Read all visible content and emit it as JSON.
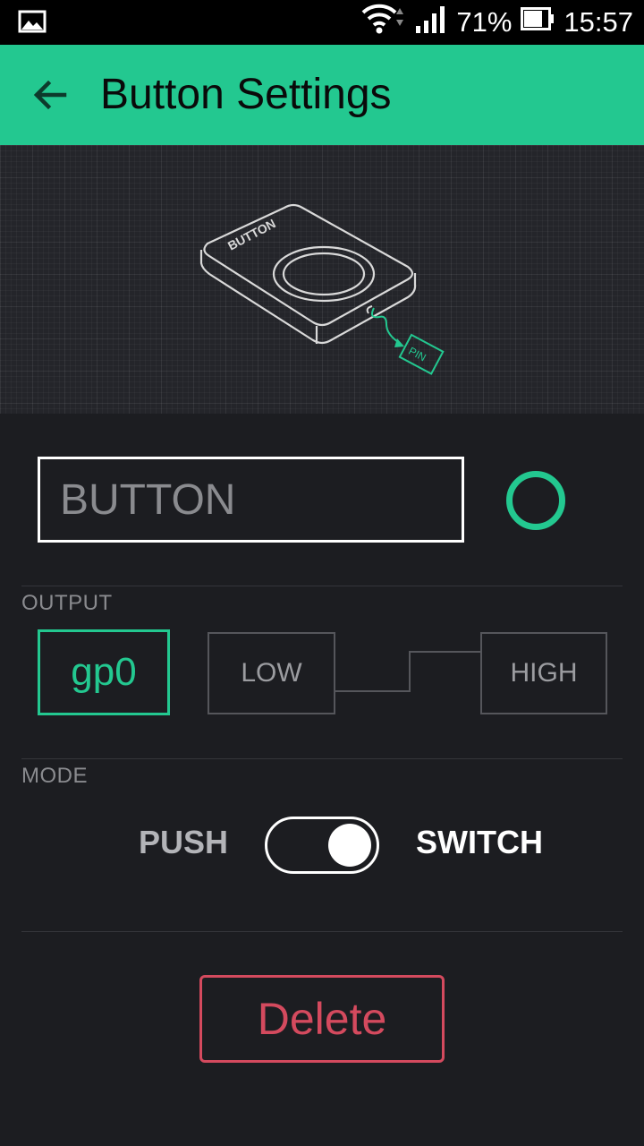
{
  "status_bar": {
    "battery_percent": "71%",
    "time": "15:57",
    "icons": [
      "gallery-notification-icon",
      "wifi-icon",
      "signal-icon",
      "battery-icon"
    ]
  },
  "app_bar": {
    "title": "Button Settings",
    "back_icon": "arrow-left-icon"
  },
  "illustration": {
    "button_label": "BUTTON",
    "pin_label": "PIN"
  },
  "name_field": {
    "value": "BUTTON"
  },
  "color": {
    "accent": "#23c890",
    "delete": "#d44a5e"
  },
  "output": {
    "section_label": "OUTPUT",
    "pin": "gp0",
    "low_label": "LOW",
    "high_label": "HIGH"
  },
  "mode": {
    "section_label": "MODE",
    "push_label": "PUSH",
    "switch_label": "SWITCH",
    "selected": "SWITCH"
  },
  "actions": {
    "delete_label": "Delete"
  }
}
